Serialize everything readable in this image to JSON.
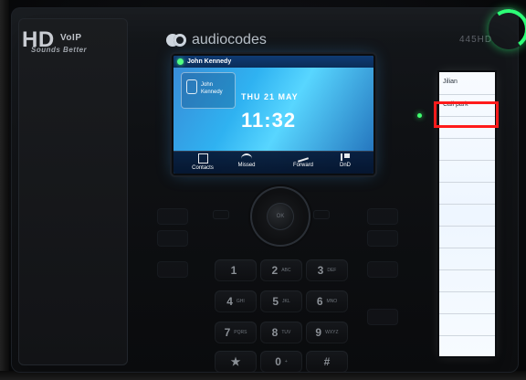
{
  "device": {
    "hd_logo": "HD",
    "hd_logo_tag": "VoIP",
    "hd_logo_sub": "Sounds Better",
    "brand": "audiocodes",
    "model": "445HD"
  },
  "screen": {
    "top_line": "John Kennedy",
    "line_key_label": "John Kennedy",
    "date": "THU 21 MAY",
    "time": "11:32",
    "softkeys": [
      {
        "label": "Contacts",
        "icon": "contacts-icon"
      },
      {
        "label": "Missed",
        "icon": "missed-icon"
      },
      {
        "label": "Forward",
        "icon": "forward-icon"
      },
      {
        "label": "DnD",
        "icon": "dnd-icon"
      }
    ]
  },
  "function_keys": {
    "labels": [
      "Jilian",
      "Call park",
      "",
      "",
      "",
      "",
      "",
      "",
      "",
      "",
      "",
      "",
      ""
    ]
  },
  "navigation": {
    "ok_label": "OK"
  },
  "dialpad": {
    "keys": [
      {
        "digit": "1",
        "letters": ""
      },
      {
        "digit": "2",
        "letters": "ABC"
      },
      {
        "digit": "3",
        "letters": "DEF"
      },
      {
        "digit": "4",
        "letters": "GHI"
      },
      {
        "digit": "5",
        "letters": "JKL"
      },
      {
        "digit": "6",
        "letters": "MNO"
      },
      {
        "digit": "7",
        "letters": "PQRS"
      },
      {
        "digit": "8",
        "letters": "TUV"
      },
      {
        "digit": "9",
        "letters": "WXYZ"
      },
      {
        "digit": "★",
        "letters": ""
      },
      {
        "digit": "0",
        "letters": "+"
      },
      {
        "digit": "#",
        "letters": ""
      }
    ]
  },
  "colors": {
    "led_green": "#2dff77",
    "highlight_red": "#ff1b1b",
    "lcd_blue": "#2fb2f1"
  }
}
